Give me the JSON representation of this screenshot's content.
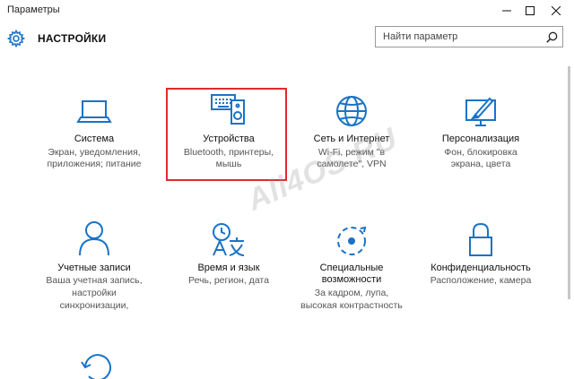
{
  "window": {
    "title": "Параметры"
  },
  "header": {
    "title": "НАСТРОЙКИ"
  },
  "search": {
    "placeholder": "Найти параметр"
  },
  "colors": {
    "accent": "#1a73c6",
    "highlight": "#e22a2a"
  },
  "tiles": [
    {
      "icon": "laptop-icon",
      "name": "Система",
      "desc": [
        "Экран, уведомления,",
        "приложения; питание"
      ]
    },
    {
      "icon": "devices-icon",
      "name": "Устройства",
      "desc": [
        "Bluetooth, принтеры,",
        "мышь"
      ]
    },
    {
      "icon": "globe-icon",
      "name": "Сеть и Интернет",
      "desc": [
        "Wi-Fi, режим \"в",
        "самолете\", VPN"
      ]
    },
    {
      "icon": "personalization-icon",
      "name": "Персонализация",
      "desc": [
        "Фон, блокировка",
        "экрана, цвета"
      ]
    },
    {
      "icon": "person-icon",
      "name": "Учетные записи",
      "desc": [
        "Ваша учетная запись,",
        "настройки",
        "синхронизации,"
      ]
    },
    {
      "icon": "time-language-icon",
      "name": "Время и язык",
      "desc": [
        "Речь, регион, дата"
      ]
    },
    {
      "icon": "accessibility-icon",
      "name": "Специальные",
      "name2": "возможности",
      "desc": [
        "За кадром, лупа,",
        "высокая контрастность"
      ]
    },
    {
      "icon": "lock-icon",
      "name": "Конфиденциальность",
      "desc": [
        "Расположение, камера"
      ]
    },
    {
      "icon": "update-icon",
      "name": "",
      "desc": []
    }
  ],
  "watermark": "All4OS.RU"
}
